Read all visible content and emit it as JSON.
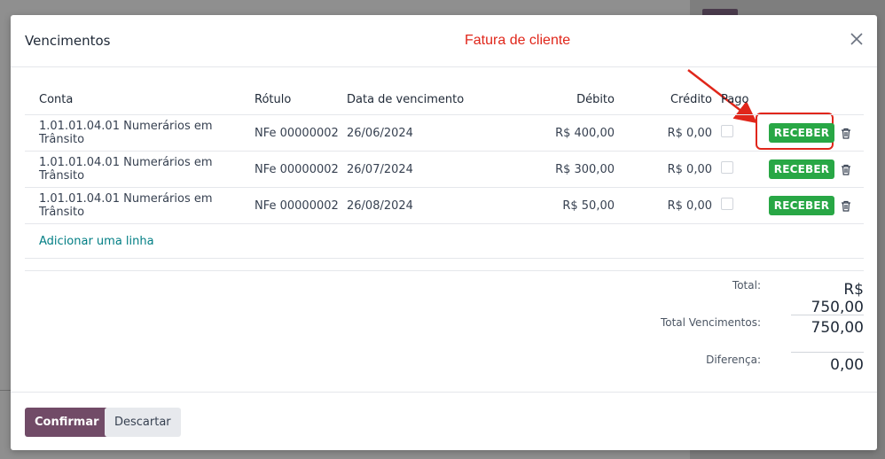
{
  "dialog": {
    "title": "Vencimentos",
    "annotation": "Fatura de cliente"
  },
  "table": {
    "headers": {
      "conta": "Conta",
      "rotulo": "Rótulo",
      "data": "Data de vencimento",
      "debito": "Débito",
      "credito": "Crédito",
      "pago": "Pago"
    },
    "rows": [
      {
        "conta": "1.01.01.04.01 Numerários em Trânsito",
        "rotulo": "NFe 00000002",
        "data": "26/06/2024",
        "debito": "R$ 400,00",
        "credito": "R$ 0,00",
        "button": "RECEBER"
      },
      {
        "conta": "1.01.01.04.01 Numerários em Trânsito",
        "rotulo": "NFe 00000002",
        "data": "26/07/2024",
        "debito": "R$ 300,00",
        "credito": "R$ 0,00",
        "button": "RECEBER"
      },
      {
        "conta": "1.01.01.04.01 Numerários em Trânsito",
        "rotulo": "NFe 00000002",
        "data": "26/08/2024",
        "debito": "R$ 50,00",
        "credito": "R$ 0,00",
        "button": "RECEBER"
      }
    ],
    "add_line": "Adicionar uma linha"
  },
  "totals": {
    "total_label": "Total:",
    "total_value": "R$ 750,00",
    "vencimentos_label": "Total Vencimentos:",
    "vencimentos_value": "750,00",
    "diferenca_label": "Diferença:",
    "diferenca_value": "0,00"
  },
  "footer": {
    "confirm": "Confirmar",
    "discard": "Descartar"
  },
  "colors": {
    "primary": "#714b67",
    "success": "#28a745",
    "annotation": "#e0261a",
    "link": "#017e84"
  }
}
